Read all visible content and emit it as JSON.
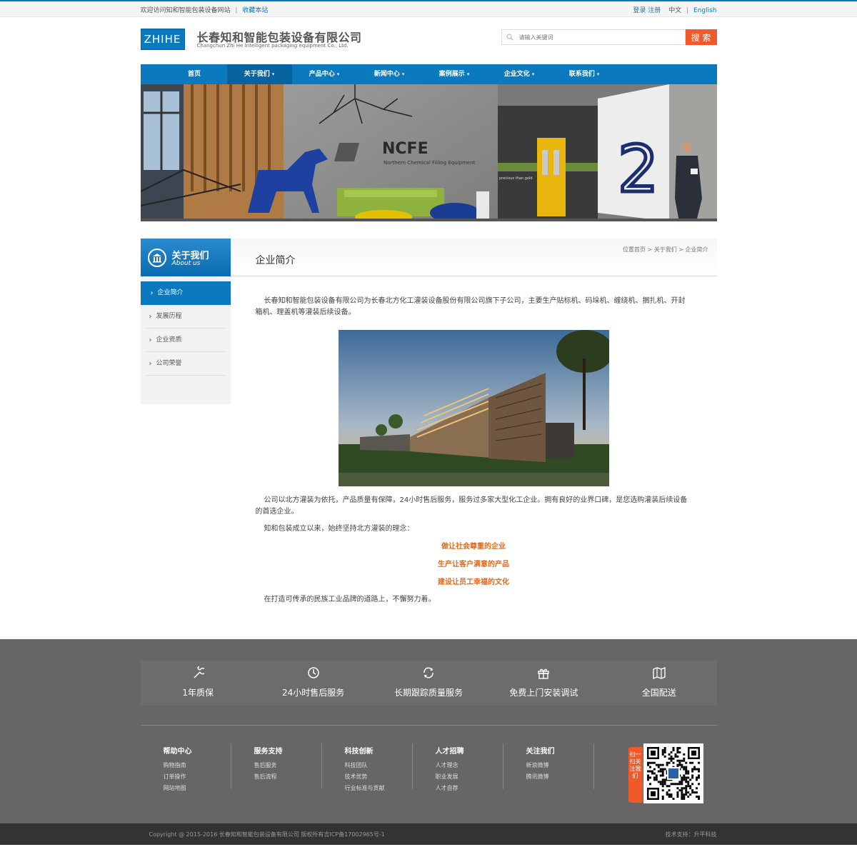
{
  "topbar": {
    "welcome": "欢迎访问知和智能包装设备网站",
    "favorite": "收藏本站",
    "login": "登录",
    "register": "注册",
    "lang_cn": "中文",
    "lang_en": "English"
  },
  "header": {
    "logo_text": "ZHIHE",
    "company_cn": "长春知和智能包装设备有限公司",
    "company_en": "Changchun Zhi He Intelligent packaging equipment Co., Ltd.",
    "search_placeholder": "请输入关键词",
    "search_button": "搜 索"
  },
  "nav": [
    {
      "label": "首页",
      "caret": false,
      "active": false
    },
    {
      "label": "关于我们",
      "caret": true,
      "active": true
    },
    {
      "label": "产品中心",
      "caret": true,
      "active": false
    },
    {
      "label": "新闻中心",
      "caret": true,
      "active": false
    },
    {
      "label": "案例展示",
      "caret": true,
      "active": false
    },
    {
      "label": "企业文化",
      "caret": true,
      "active": false
    },
    {
      "label": "联系我们",
      "caret": true,
      "active": false
    }
  ],
  "banner": {
    "brand": "NCFE",
    "brand_sub": "Northern Chemical Filling Equipment",
    "wall_number": "2",
    "wall_text": "precious than gold"
  },
  "sidebar": {
    "title_cn": "关于我们",
    "title_en": "About us",
    "items": [
      "企业简介",
      "发展历程",
      "企业资质",
      "公司荣誉"
    ]
  },
  "content": {
    "breadcrumb": "位置首页 > 关于我们 > 企业简介",
    "title": "企业简介",
    "para1": "长春知和智能包装设备有限公司为长春北方化工灌装设备股份有限公司旗下子公司，主要生产贴标机、码垛机、缠绕机、捆扎机、开封箱机、理盖机等灌装后续设备。",
    "para2": "公司以北方灌装为依托，产品质量有保障，24小时售后服务，服务过多家大型化工企业。拥有良好的业界口碑，是您选购灌装后续设备的首选企业。",
    "para3": "知和包装成立以来，始终坚持北方灌装的理念：",
    "slogans": [
      "做让社会尊重的企业",
      "生产让客户满意的产品",
      "建设让员工幸福的文化"
    ],
    "para4": "在打造可传承的民族工业品牌的道路上，不懈努力着。"
  },
  "services": [
    {
      "icon": "wrench-icon",
      "label": "1年质保"
    },
    {
      "icon": "clock-icon",
      "label": "24小时售后服务"
    },
    {
      "icon": "refresh-icon",
      "label": "长期跟踪质量服务"
    },
    {
      "icon": "gift-icon",
      "label": "免费上门安装调试"
    },
    {
      "icon": "map-icon",
      "label": "全国配送"
    }
  ],
  "footer_cols": [
    {
      "title": "帮助中心",
      "links": [
        "购物指南",
        "订单操作",
        "网站地图"
      ]
    },
    {
      "title": "服务支持",
      "links": [
        "售后服务",
        "售后流程"
      ]
    },
    {
      "title": "科技创新",
      "links": [
        "科技团队",
        "技术优势",
        "行业标准与贡献"
      ]
    },
    {
      "title": "人才招聘",
      "links": [
        "人才理念",
        "职业发展",
        "人才自荐"
      ]
    },
    {
      "title": "关注我们",
      "links": [
        "新浪微博",
        "腾讯微博"
      ]
    }
  ],
  "qr_tag": "扫一扫关注我们",
  "copyright": "Copyright @ 2015-2016 长春知和智能包装设备有限公司 版权所有吉ICP备17002965号-1",
  "tech_support": "技术支持：升平科技",
  "colors": {
    "primary": "#0a79bd",
    "accent": "#f05a28",
    "slogan": "#e06a1c",
    "footer": "#666666"
  }
}
